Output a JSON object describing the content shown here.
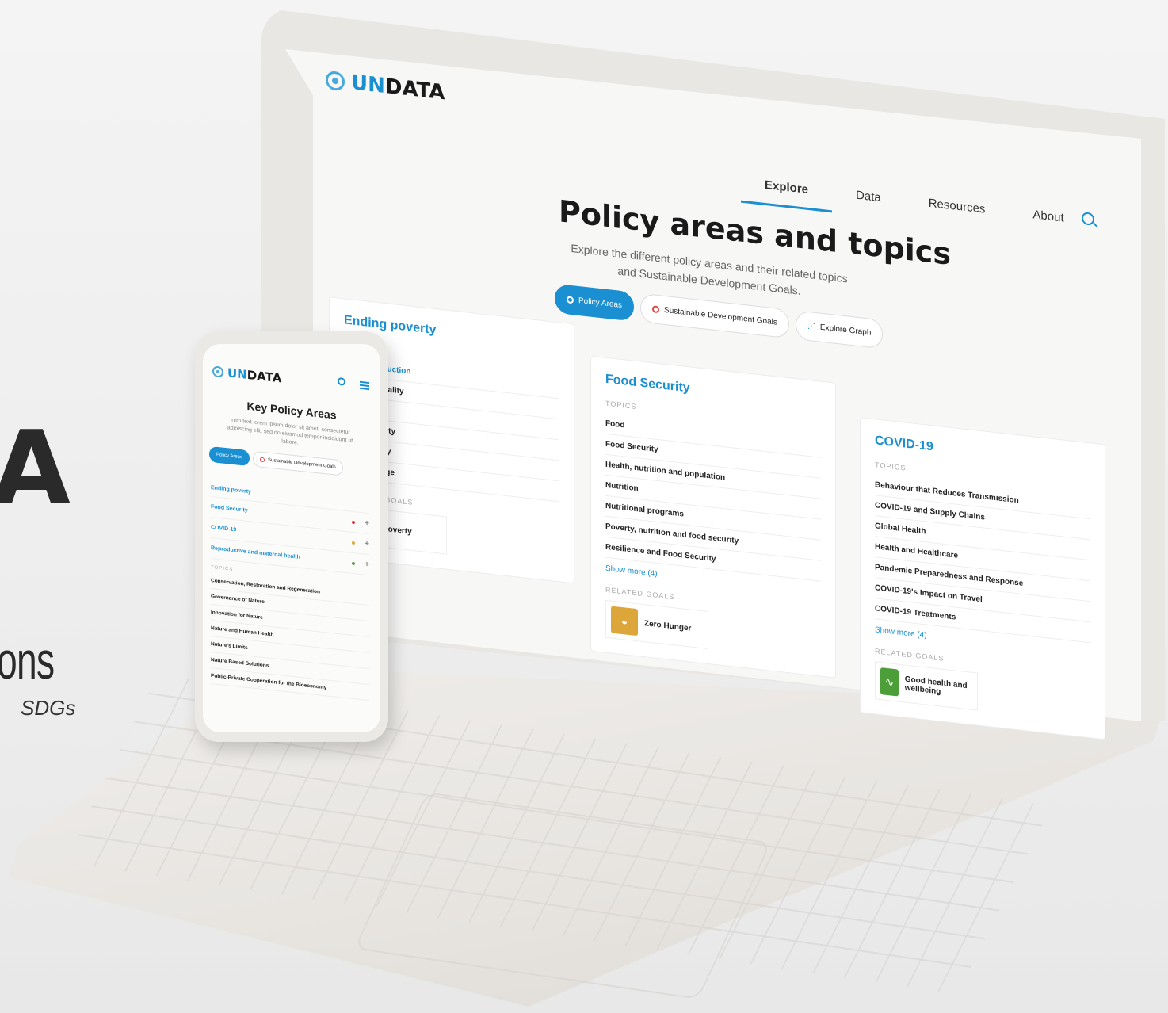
{
  "promo": {
    "big": "A",
    "line": "ons",
    "sub": "SDGs"
  },
  "laptop": {
    "logo": {
      "un": "UN",
      "rest": "DATA"
    },
    "nav": [
      "Explore",
      "Data",
      "Resources",
      "About"
    ],
    "title": "Policy areas and topics",
    "subtitle": "Explore the different policy areas and their related topics and Sustainable Development Goals.",
    "pills": [
      "Policy Areas",
      "Sustainable Development Goals",
      "Explore Graph"
    ],
    "topics_label": "TOPICS",
    "related_label": "RELATED GOALS",
    "cards": [
      {
        "title": "Ending poverty",
        "topics": [
          "poverty reduction",
          "y and inequality",
          "rty",
          "s and poverty",
          "onal poverty",
          "",
          "imate change"
        ],
        "show_more": "",
        "goal": {
          "name": "Poverty",
          "color": "#e5243b"
        }
      },
      {
        "title": "Food Security",
        "topics": [
          "Food",
          "Food Security",
          "Health, nutrition and population",
          "Nutrition",
          "Nutritional programs",
          "Poverty, nutrition and food security",
          "Resilience and Food Security"
        ],
        "show_more": "Show more (4)",
        "goal": {
          "name": "Zero Hunger",
          "color": "#dda63a"
        }
      },
      {
        "title": "COVID-19",
        "topics": [
          "Behaviour that Reduces Transmission",
          "COVID-19 and Supply Chains",
          "Global Health",
          "Health and Healthcare",
          "Pandemic Preparedness and Response",
          "COVID-19's Impact on Travel",
          "COVID-19 Treatments"
        ],
        "show_more": "Show more (4)",
        "goal": {
          "name": "Good health and wellbeing",
          "color": "#4c9f38"
        }
      }
    ]
  },
  "phone": {
    "logo": {
      "un": "UN",
      "rest": "DATA"
    },
    "title": "Key Policy Areas",
    "subtitle": "Intro text lorem ipsum dolor sit amet, consectetur adipiscing elit, sed do eiusmod tempor incididunt ut labore.",
    "pills": [
      "Policy Areas",
      "Sustainable Development Goals"
    ],
    "areas": [
      {
        "name": "Ending poverty",
        "dot": ""
      },
      {
        "name": "Food Security",
        "dot": "#e5243b"
      },
      {
        "name": "COVID-19",
        "dot": "#dda63a"
      },
      {
        "name": "Reproductive and maternal health",
        "dot": "#4c9f38"
      }
    ],
    "topics_label": "TOPICS",
    "topics": [
      "Conservation, Restoration and Regeneration",
      "Governance of Nature",
      "Innovation for Nature",
      "Nature and Human Health",
      "Nature's Limits",
      "Nature Based Solutions",
      "Public-Private Cooperation for the Bioeconomy"
    ]
  }
}
